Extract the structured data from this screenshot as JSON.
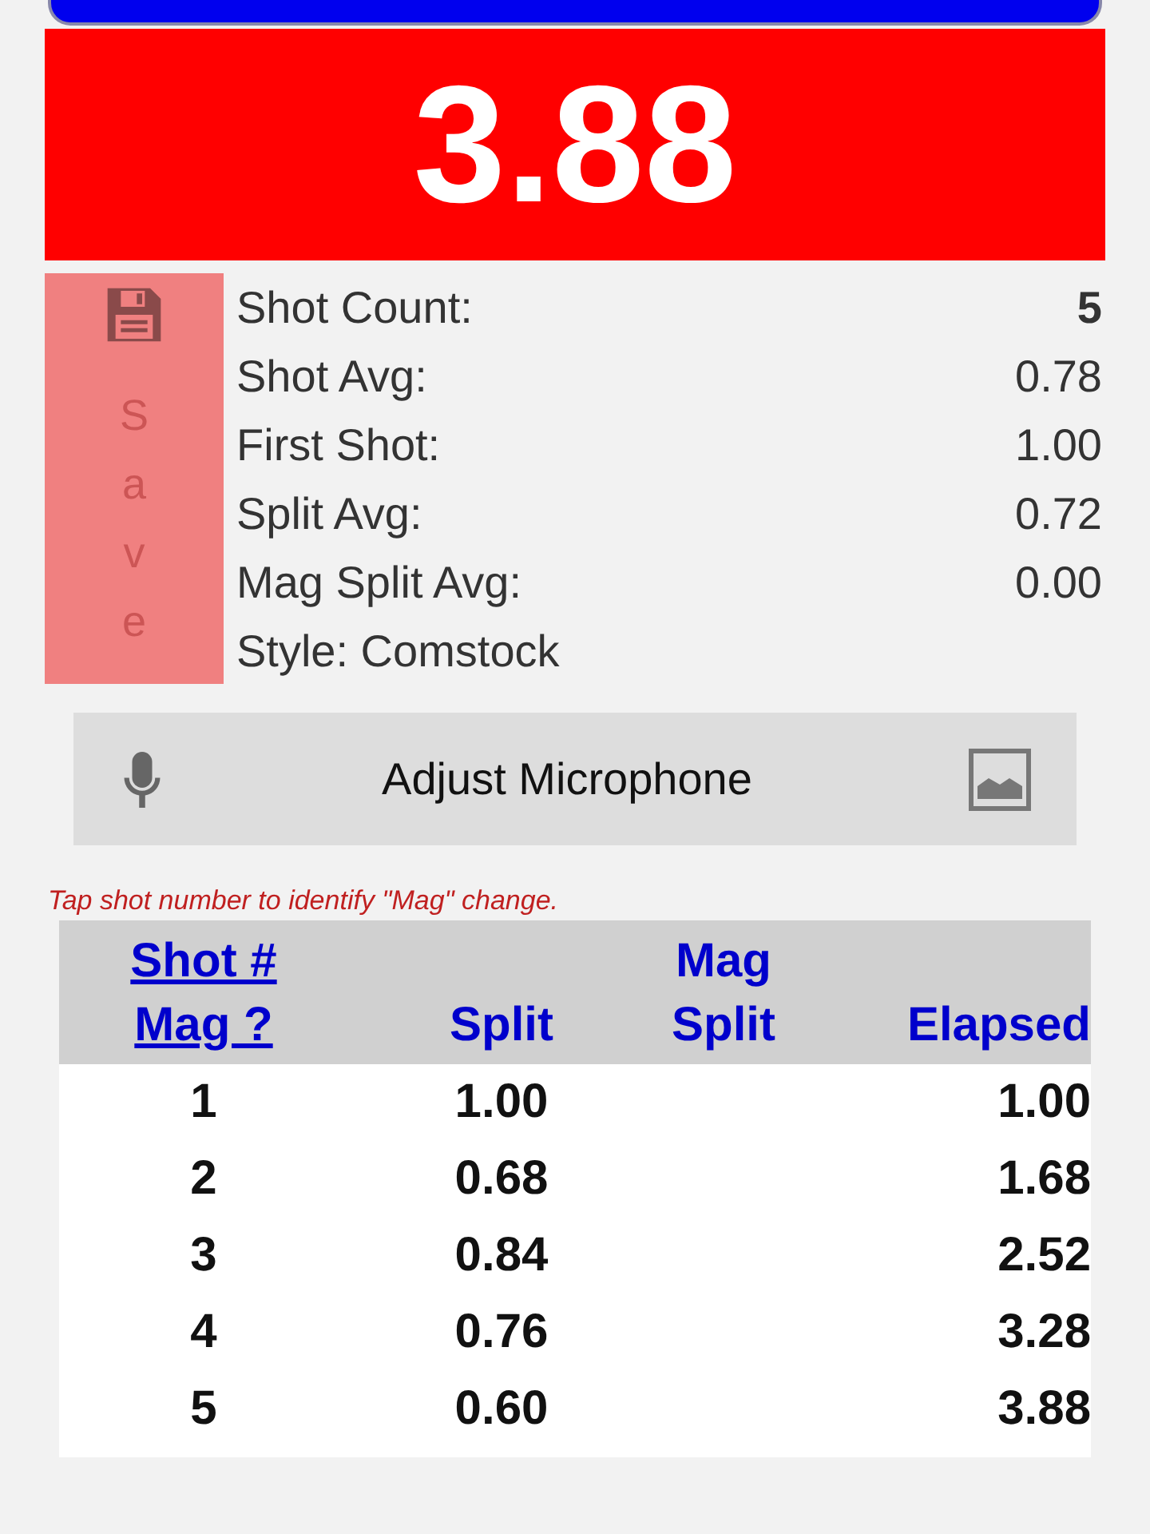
{
  "timer": {
    "value": "3.88"
  },
  "save_button": {
    "label": "Save"
  },
  "stats": [
    {
      "label": "Shot Count:",
      "value": "5",
      "bold": true
    },
    {
      "label": "Shot Avg:",
      "value": "0.78",
      "bold": false
    },
    {
      "label": "First Shot:",
      "value": "1.00",
      "bold": false
    },
    {
      "label": "Split Avg:",
      "value": "0.72",
      "bold": false
    },
    {
      "label": "Mag Split Avg:",
      "value": "0.00",
      "bold": false
    },
    {
      "label": "Style: Comstock"
    }
  ],
  "mic_button": {
    "label": "Adjust Microphone"
  },
  "hint": "Tap shot number to identify \"Mag\" change.",
  "table": {
    "columns": [
      {
        "lines": [
          "Shot #",
          "Mag ?"
        ],
        "link": true
      },
      {
        "lines": [
          "Split"
        ],
        "link": false
      },
      {
        "lines": [
          "Mag",
          "Split"
        ],
        "link": false
      },
      {
        "lines": [
          "Elapsed"
        ],
        "link": false
      }
    ],
    "rows": [
      {
        "shot": "1",
        "split": "1.00",
        "elapsed": "1.00"
      },
      {
        "shot": "2",
        "split": "0.68",
        "elapsed": "1.68"
      },
      {
        "shot": "3",
        "split": "0.84",
        "elapsed": "2.52"
      },
      {
        "shot": "4",
        "split": "0.76",
        "elapsed": "3.28"
      },
      {
        "shot": "5",
        "split": "0.60",
        "elapsed": "3.88"
      }
    ]
  }
}
